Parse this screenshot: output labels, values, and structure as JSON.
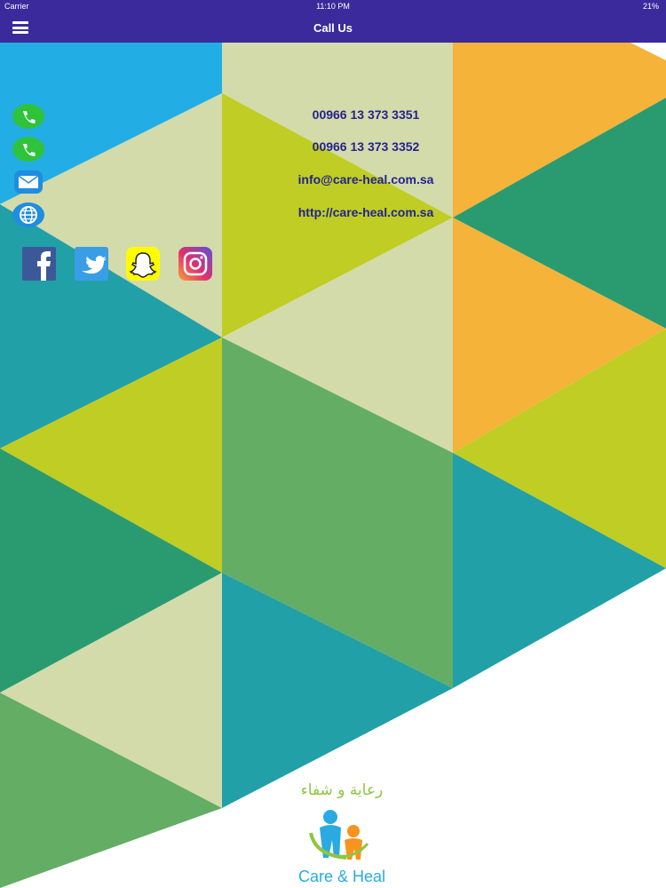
{
  "status_bar": {
    "carrier": "Carrier",
    "time": "11:10 PM",
    "battery": "21%"
  },
  "nav": {
    "title": "Call Us",
    "menu_icon": "hamburger-icon"
  },
  "contacts": {
    "phone_1": "00966 13 373 3351",
    "phone_2": "00966 13 373 3352",
    "email": "info@care-heal.com.sa",
    "website": "http://care-heal.com.sa"
  },
  "social": [
    "facebook-icon",
    "twitter-icon",
    "snapchat-icon",
    "instagram-icon"
  ],
  "logo": {
    "arabic": "رعاية و شفاء",
    "english": "Care & Heal"
  },
  "colors": {
    "nav_bg": "#3a2a9c",
    "link_text": "#24238f",
    "blue": "#22aee4",
    "teal": "#21a0a8",
    "green": "#2a9b70",
    "lime": "#bfcd24",
    "pale": "#d3dbaa",
    "orange": "#f5b33a",
    "sage": "#63ad65"
  }
}
